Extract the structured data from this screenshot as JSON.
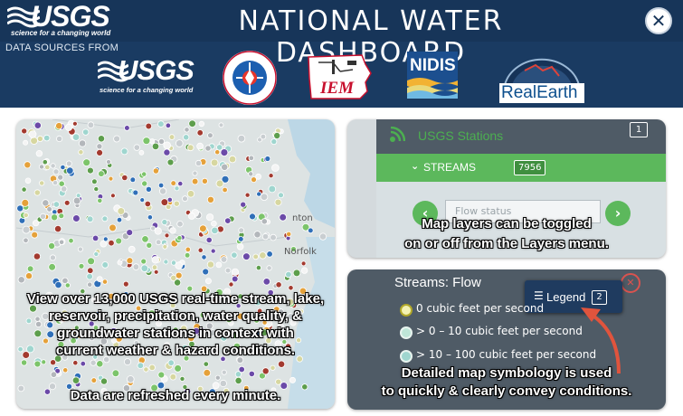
{
  "header": {
    "title": "NATIONAL WATER DASHBOARD",
    "brand_word": "USGS",
    "brand_tagline": "science for a changing world",
    "data_sources_label": "DATA SOURCES FROM",
    "close_icon": "close-icon",
    "colors": {
      "header_bg": "#1a3b62",
      "accent": "#ffffff"
    }
  },
  "sources": [
    {
      "name": "USGS",
      "tagline": "science for a changing world"
    },
    {
      "name": "National Weather Service",
      "text": "NATIONAL WEATHER SERVICE"
    },
    {
      "name": "IEM",
      "text": "IEM"
    },
    {
      "name": "NIDIS",
      "text": "NIDIS"
    },
    {
      "name": "RealEarth",
      "text": "RealEarth"
    }
  ],
  "map_panel": {
    "labels": [
      "Norfolk",
      "nton"
    ],
    "caption_lines": [
      "View over 13,000 USGS real-time stream, lake,",
      "reservoir, precipitation, water quality, &",
      "groundwater stations in context with",
      "current weather & hazard conditions."
    ],
    "refresh_note": "Data are refreshed every minute."
  },
  "layers_panel": {
    "title": "USGS Stations",
    "count": "1",
    "stream_label": "STREAMS",
    "stream_count": "7956",
    "select_placeholder": "Flow status",
    "caption_lines": [
      "Map layers can be toggled",
      "on or off from the Layers menu."
    ],
    "colors": {
      "green": "#4caf50"
    }
  },
  "legend_panel": {
    "title": "Streams: Flow",
    "legend_button": "Legend",
    "legend_count": "2",
    "items": [
      {
        "label": "0 cubic feet per second",
        "color": "#f3f1b2"
      },
      {
        "label": "> 0 – 10 cubic feet per second",
        "color": "#bfe6d8"
      },
      {
        "label": "> 10 – 100 cubic feet per second",
        "color": "#9fd6cf"
      }
    ],
    "caption_lines": [
      "Detailed map symbology is used",
      "to quickly & clearly convey conditions."
    ]
  }
}
